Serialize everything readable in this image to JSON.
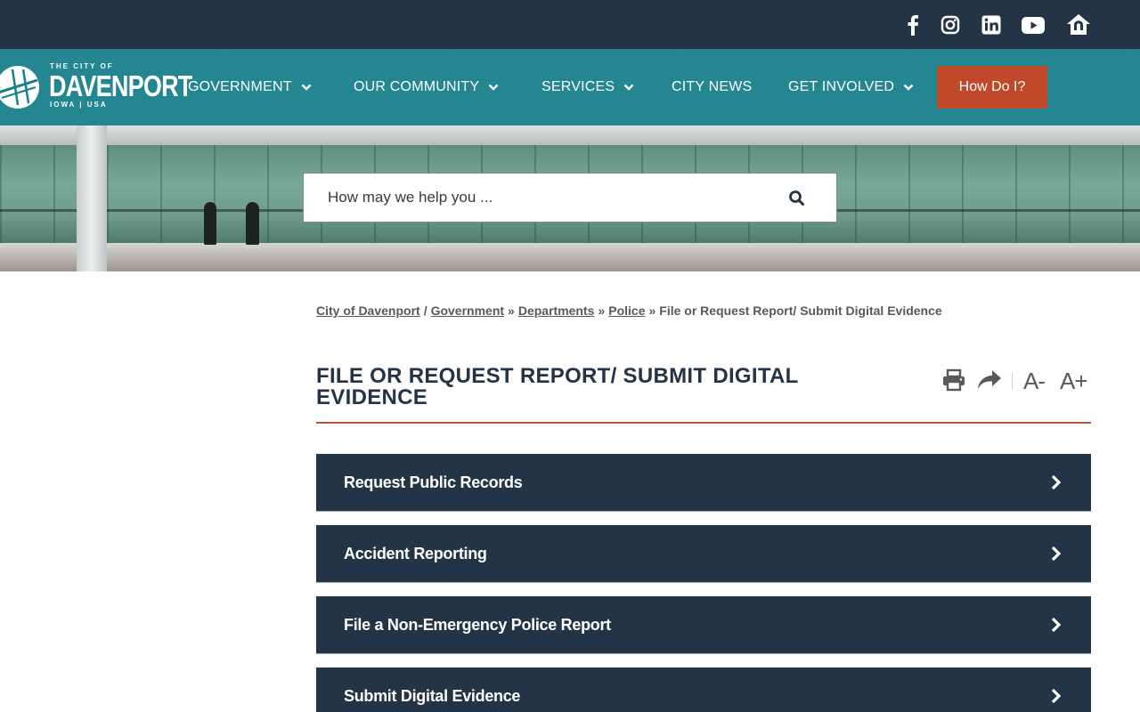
{
  "social": {
    "facebook": "facebook-icon",
    "instagram": "instagram-icon",
    "linkedin": "linkedin-icon",
    "youtube": "youtube-icon",
    "nextdoor": "nextdoor-icon"
  },
  "logo": {
    "top": "THE CITY OF",
    "name": "DAVENPORT",
    "sub": "IOWA | USA"
  },
  "nav": {
    "items": [
      {
        "label": "GOVERNMENT"
      },
      {
        "label": "OUR COMMUNITY"
      },
      {
        "label": "SERVICES"
      },
      {
        "label": "CITY NEWS"
      },
      {
        "label": "GET INVOLVED"
      }
    ],
    "how_do_i": "How Do I?"
  },
  "search": {
    "placeholder": "How may we help you ..."
  },
  "breadcrumb": {
    "items": [
      "City of Davenport",
      "Government",
      "Departments",
      "Police"
    ],
    "seps": [
      "/",
      "»",
      "»",
      "»"
    ],
    "current": "File or Request Report/ Submit Digital Evidence"
  },
  "page": {
    "title": "FILE OR REQUEST REPORT/ SUBMIT DIGITAL EVIDENCE",
    "font_decrease": "A-",
    "font_increase": "A+"
  },
  "accordion": {
    "items": [
      {
        "label": "Request Public Records"
      },
      {
        "label": "Accident Reporting"
      },
      {
        "label": "File a Non-Emergency Police Report"
      },
      {
        "label": "Submit Digital Evidence"
      }
    ]
  },
  "colors": {
    "dark_navy": "#233447",
    "teal": "#17808c",
    "accent_red": "#c0492c"
  }
}
